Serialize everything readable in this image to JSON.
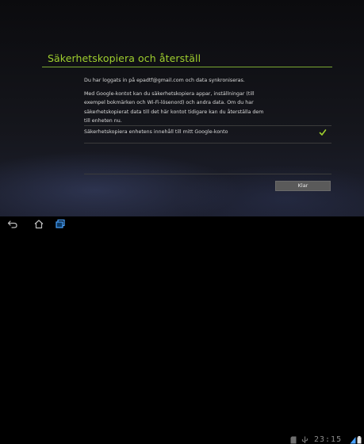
{
  "dialog": {
    "title": "Säkerhetskopiera och återställ",
    "logged_in_text": "Du har loggats in på epadtf@gmail.com och data synkroniseras.",
    "description": "Med Google-kontot kan du säkerhetskopiera appar, inställningar (till exempel bokmärken och Wi-Fi-lösenord) och andra data. Om du har säkerhetskopierat data till det här kontot tidigare kan du återställa dem till enheten nu.",
    "backup_option_label": "Säkerhetskopiera enhetens innehåll till mitt Google-konto",
    "backup_option_checked": true,
    "done_button_label": "Klar"
  },
  "status_bar": {
    "clock": "23:15"
  },
  "icons": {
    "back": "back-arrow-icon",
    "home": "home-icon",
    "recent": "recent-apps-icon",
    "checkmark": "checkmark-icon"
  },
  "colors": {
    "accent": "#9fcf2e",
    "text": "#d9d9d9",
    "button": "#5a5a5a"
  }
}
